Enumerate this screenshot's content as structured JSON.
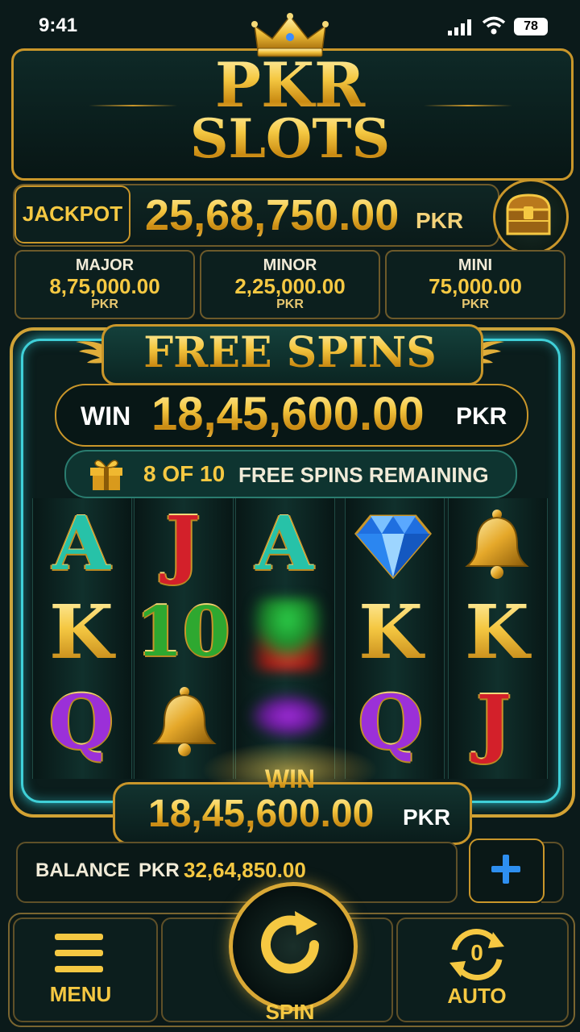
{
  "status_bar": {
    "time": "9:41",
    "battery": "78"
  },
  "title": {
    "line1": "PKR",
    "line2": "SLOTS"
  },
  "jackpot": {
    "label": "JACKPOT",
    "value": "25,68,750.00",
    "unit": "PKR"
  },
  "tiers": [
    {
      "name": "MAJOR",
      "value": "8,75,000.00",
      "unit": "PKR"
    },
    {
      "name": "MINOR",
      "value": "2,25,000.00",
      "unit": "PKR"
    },
    {
      "name": "MINI",
      "value": "75,000.00",
      "unit": "PKR"
    }
  ],
  "free_spins": {
    "title": "FREE SPINS",
    "win_label": "WIN",
    "win_value": "18,45,600.00",
    "win_unit": "PKR",
    "remaining_count": "8 OF 10",
    "remaining_text": "FREE SPINS REMAINING"
  },
  "reels": {
    "row1": [
      "A",
      "J",
      "A",
      "diamond-icon",
      "bell-icon"
    ],
    "row2": [
      "K",
      "10",
      "spinning",
      "K",
      "K"
    ],
    "row3": [
      "Q",
      "bell-icon",
      "spinning",
      "Q",
      "J"
    ]
  },
  "total_win": {
    "label": "WIN",
    "value": "18,45,600.00",
    "unit": "PKR"
  },
  "balance": {
    "label": "BALANCE",
    "unit": "PKR",
    "value": "32,64,850.00"
  },
  "controls": {
    "menu_label": "MENU",
    "spin_label": "SPIN",
    "auto_label": "AUTO",
    "auto_count": "0"
  },
  "colors": {
    "gold": "#f5c842",
    "frame_gold": "#c9962a",
    "neon_teal": "#3fd0d8",
    "background": "#0b1a1a"
  }
}
